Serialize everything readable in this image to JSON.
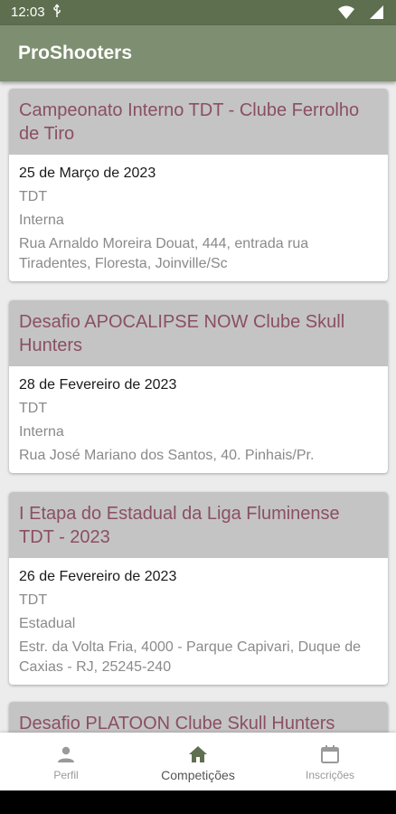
{
  "status": {
    "time": "12:03"
  },
  "app": {
    "title": "ProShooters"
  },
  "cards": [
    {
      "title": "Campeonato Interno TDT - Clube Ferrolho de Tiro",
      "date": "25 de Março de 2023",
      "modality": "TDT",
      "type": "Interna",
      "address": "Rua Arnaldo Moreira Douat, 444, entrada rua Tiradentes, Floresta, Joinville/Sc"
    },
    {
      "title": "Desafio APOCALIPSE NOW Clube Skull Hunters",
      "date": "28 de Fevereiro de 2023",
      "modality": "TDT",
      "type": "Interna",
      "address": "Rua José Mariano dos Santos, 40. Pinhais/Pr."
    },
    {
      "title": "I Etapa do Estadual da Liga Fluminense TDT - 2023",
      "date": "26 de Fevereiro de 2023",
      "modality": "TDT",
      "type": "Estadual",
      "address": "Estr. da Volta Fria, 4000 - Parque Capivari, Duque de Caxias - RJ, 25245-240"
    },
    {
      "title": "Desafio PLATOON Clube Skull Hunters"
    }
  ],
  "nav": {
    "perfil": "Perfil",
    "competicoes": "Competições",
    "inscricoes": "Inscrições"
  },
  "colors": {
    "appbar": "#7e8e70",
    "card_title": "#8a4f63",
    "card_header_bg": "#c4c4c4"
  },
  "icons": [
    "usb-icon",
    "wifi-icon",
    "signal-icon",
    "person-icon",
    "home-icon",
    "calendar-icon"
  ]
}
